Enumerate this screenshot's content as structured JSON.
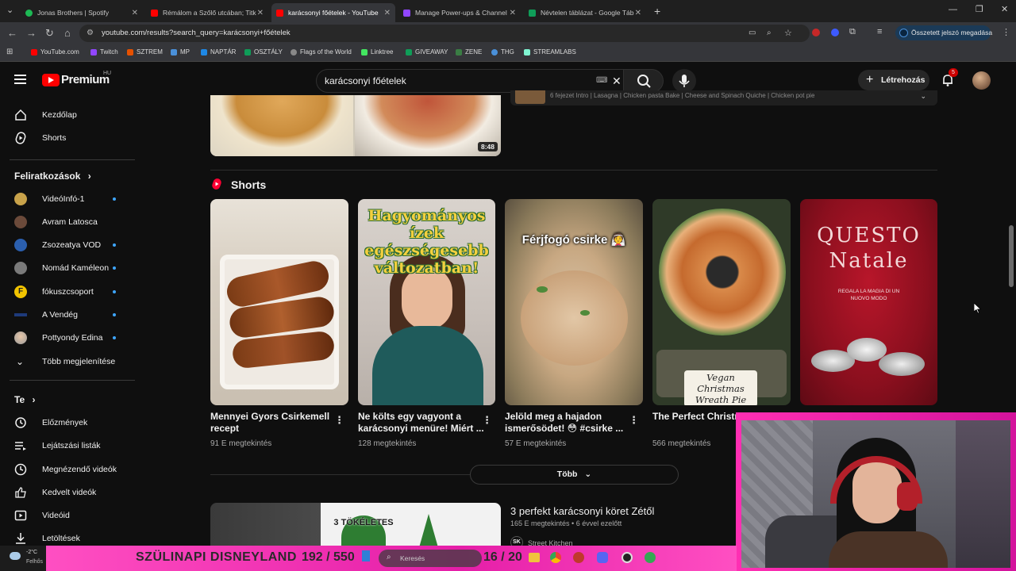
{
  "browser": {
    "tabs": [
      {
        "title": "Jonas Brothers | Spotify",
        "color": "#1db954"
      },
      {
        "title": "Rémálom a Szőlő utcában; Titk",
        "color": "#ff0000"
      },
      {
        "title": "karácsonyi főételek - YouTube",
        "color": "#ff0000"
      },
      {
        "title": "Manage Power-ups & Channel",
        "color": "#9146ff"
      },
      {
        "title": "Névtelen táblázat - Google Táb",
        "color": "#0f9d58"
      }
    ],
    "url": "youtube.com/results?search_query=karácsonyi+főételek",
    "password_button": "Összetett jelszó megadása",
    "bookmarks": [
      "YouTube.com",
      "Twitch",
      "SZTREM",
      "MP",
      "NAPTÁR",
      "OSZTÁLY",
      "Flags of the World",
      "Linktree",
      "GIVEAWAY",
      "ZENE",
      "THG",
      "STREAMLABS"
    ]
  },
  "youtube": {
    "logo_text": "Premium",
    "region": "HU",
    "search_value": "karácsonyi főételek",
    "create_label": "Létrehozás",
    "notif_count": "5",
    "accent_color": "#ff0000"
  },
  "sidebar": {
    "home": "Kezdőlap",
    "shorts": "Shorts",
    "subs_header": "Feliratkozások",
    "subs": [
      {
        "name": "VideóInfó-1",
        "live": true,
        "color": "#c8a24a"
      },
      {
        "name": "Avram Latosca",
        "live": false,
        "color": "#6b4a3a"
      },
      {
        "name": "Zsozeatya VOD",
        "live": true,
        "color": "#2b5fae"
      },
      {
        "name": "Nomád Kaméleon",
        "live": true,
        "color": "#7a7a7a"
      },
      {
        "name": "fókuszcsoport",
        "live": true,
        "color": "#f2c400"
      },
      {
        "name": "A Vendég",
        "live": true,
        "color": "#1e3a7a"
      },
      {
        "name": "Pottyondy Edina",
        "live": true,
        "color": "#d9d9d9"
      }
    ],
    "show_more": "Több megjelenítése",
    "you_header": "Te",
    "you_items": [
      "Előzmények",
      "Lejátszási listák",
      "Megnézendő videók",
      "Kedvelt videók",
      "Videóid",
      "Letöltések"
    ]
  },
  "results": {
    "top_duration": "8:48",
    "top_chapters": "6 fejezet  Intro | Lasagna | Chicken pasta Bake | Cheese and Spinach Quiche | Chicken pot pie",
    "shorts_header": "Shorts",
    "shorts": [
      {
        "title": "Mennyei Gyors Csirkemell recept",
        "views": "91 E megtekintés",
        "overlay": ""
      },
      {
        "title": "Ne költs egy vagyont a karácsonyi menüre! Miért ...",
        "views": "128 megtekintés",
        "overlay": "Hagyományos ízek egészségesebb változatban!"
      },
      {
        "title": "Jelöld meg a hajadon ismerősödet! 😳 #csirke ...",
        "views": "57 E megtekintés",
        "overlay": "Férjfogó csirke 👰"
      },
      {
        "title": "The Perfect Christmas Main, Vegan Christmas ...",
        "views": "566 megtekintés",
        "overlay": "Vegan Christmas Wreath Pie"
      },
      {
        "title": "",
        "views": "",
        "overlay": "QUESTO Natale",
        "sub": "REGALA LA MAGIA DI UN NUOVO MODO"
      }
    ],
    "more_button": "Több",
    "next_video": {
      "title": "3 perfekt karácsonyi köret Zétől",
      "meta": "165 E megtekintés • 6 évvel ezelőtt",
      "channel": "Street Kitchen",
      "thumb_text": "3 TÖKÉLETES"
    }
  },
  "stream_overlay": {
    "banner": "SZÜLINAPI DISNEYLAND",
    "progress_text": "192 / 550",
    "count_text": "16 / 20"
  },
  "taskbar": {
    "temp": "-2°C",
    "weather": "Felhős",
    "search_placeholder": "Keresés"
  }
}
